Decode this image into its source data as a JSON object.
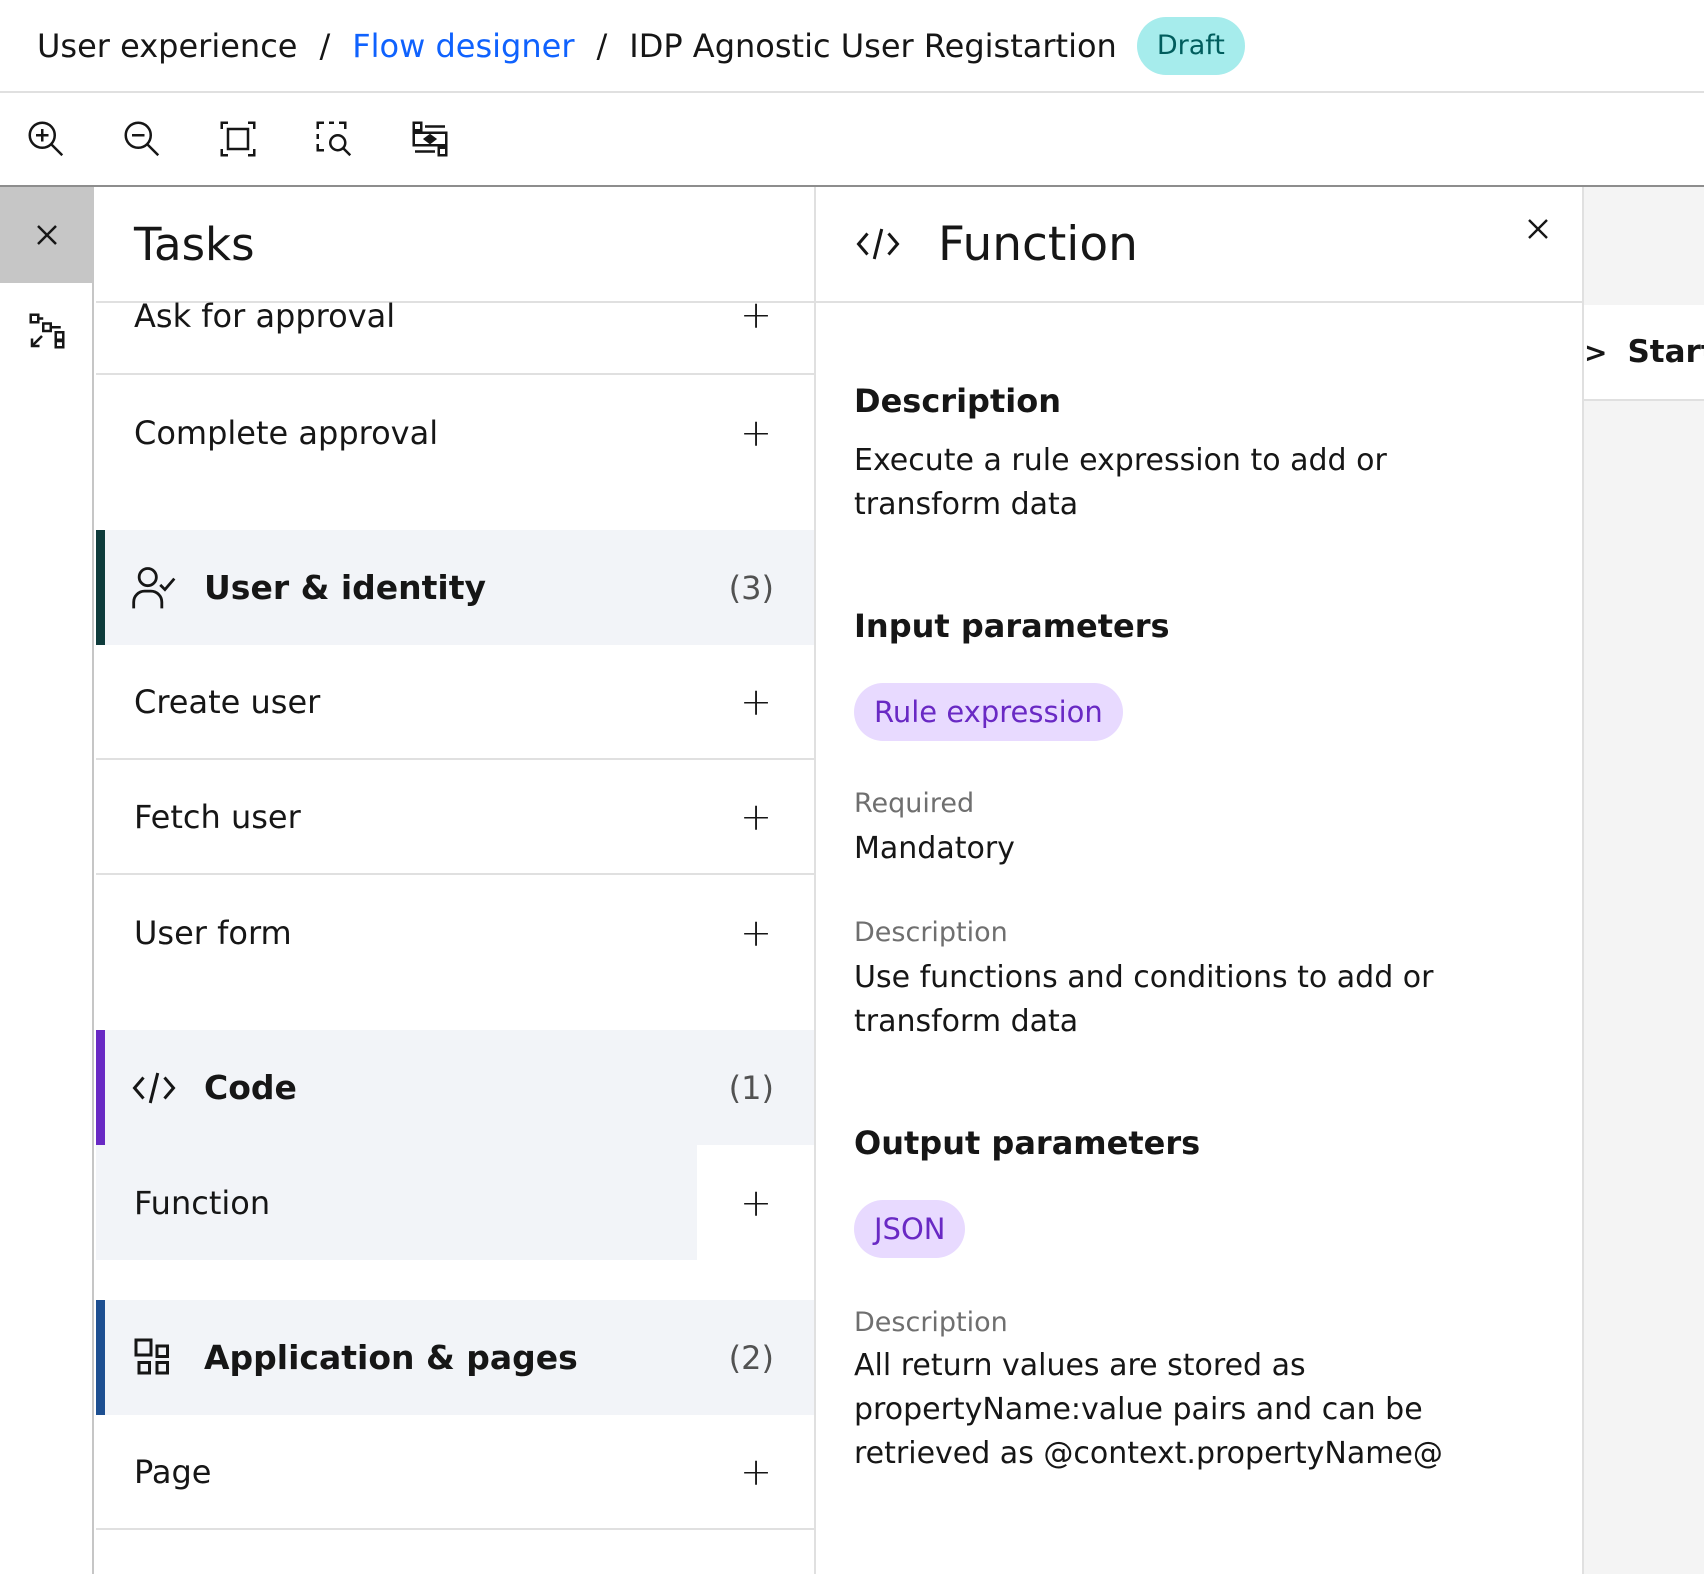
{
  "breadcrumb": {
    "item1": "User experience",
    "item2": "Flow designer",
    "item3": "IDP Agnostic User Registartion",
    "separator": "/",
    "status_badge": "Draft"
  },
  "toolbar": {
    "icons": [
      "zoom-in-icon",
      "zoom-out-icon",
      "fit-to-screen-icon",
      "zoom-area-icon",
      "center-view-icon"
    ]
  },
  "rail": {
    "icons": [
      "close-icon",
      "flow-tasks-icon"
    ]
  },
  "tasks": {
    "title": "Tasks",
    "plus": "+",
    "approval_items": [
      "Ask for approval",
      "Complete approval"
    ],
    "categories": [
      {
        "label": "User & identity",
        "count": "(3)",
        "color": "#0e3b3b",
        "icon": "user-check-icon",
        "items": [
          "Create user",
          "Fetch user",
          "User form"
        ]
      },
      {
        "label": "Code",
        "count": "(1)",
        "color": "#6929c4",
        "icon": "code-icon",
        "items": [
          "Function"
        ]
      },
      {
        "label": "Application & pages",
        "count": "(2)",
        "color": "#1d4f91",
        "icon": "apps-icon",
        "items": [
          "Page"
        ]
      }
    ]
  },
  "detail": {
    "title": "Function",
    "icon": "code-icon",
    "description_heading": "Description",
    "description_text": "Execute a rule expression to add or transform data",
    "input_heading": "Input parameters",
    "input_tag": "Rule expression",
    "required_label": "Required",
    "required_value": "Mandatory",
    "input_desc_label": "Description",
    "input_desc_text": "Use functions and conditions to add or transform data",
    "output_heading": "Output parameters",
    "output_tag": "JSON",
    "output_desc_label": "Description",
    "output_desc_text": "All return values are stored as propertyName:value pairs and can be retrieved as @context.propertyName@"
  },
  "canvas": {
    "node_chevron": ">",
    "node_label": "Start"
  },
  "colors": {
    "link": "#0f62fe",
    "badge_bg": "#a6ecec",
    "tag_bg": "#e8daff",
    "tag_text": "#6929c4",
    "category_bg": "#f2f4f8"
  }
}
